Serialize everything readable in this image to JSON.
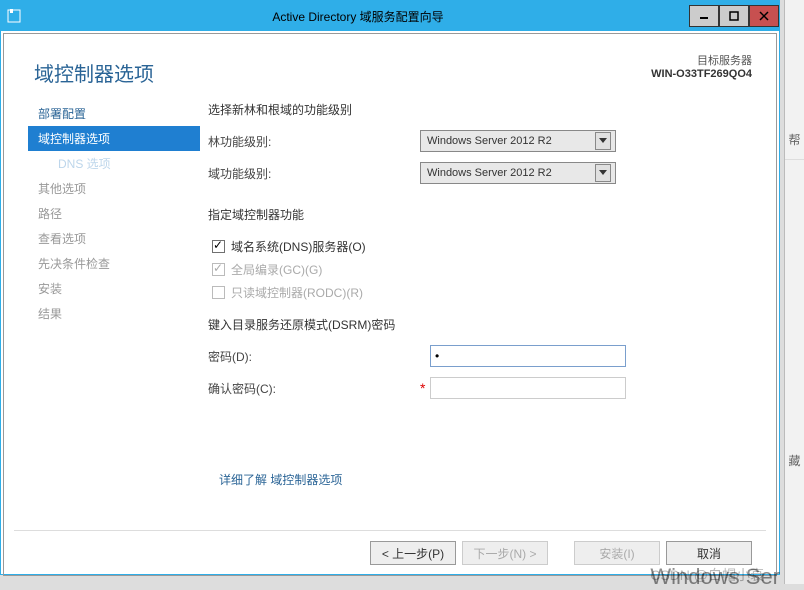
{
  "titlebar": {
    "title": "Active Directory 域服务配置向导"
  },
  "header": {
    "page_title": "域控制器选项",
    "server_label": "目标服务器",
    "server_name": "WIN-O33TF269QO4"
  },
  "sidebar": {
    "items": [
      {
        "label": "部署配置",
        "class": "link"
      },
      {
        "label": "域控制器选项",
        "class": "active"
      },
      {
        "label": "DNS 选项",
        "class": "sub"
      },
      {
        "label": "其他选项",
        "class": ""
      },
      {
        "label": "路径",
        "class": ""
      },
      {
        "label": "查看选项",
        "class": ""
      },
      {
        "label": "先决条件检查",
        "class": ""
      },
      {
        "label": "安装",
        "class": ""
      },
      {
        "label": "结果",
        "class": ""
      }
    ]
  },
  "main": {
    "section1_head": "选择新林和根域的功能级别",
    "forest_label": "林功能级别:",
    "forest_value": "Windows Server 2012 R2",
    "domain_label": "域功能级别:",
    "domain_value": "Windows Server 2012 R2",
    "section2_head": "指定域控制器功能",
    "cb_dns": "域名系统(DNS)服务器(O)",
    "cb_gc": "全局编录(GC)(G)",
    "cb_rodc": "只读域控制器(RODC)(R)",
    "section3_head": "键入目录服务还原模式(DSRM)密码",
    "pwd_label": "密码(D):",
    "pwd_value": "•",
    "confirm_label": "确认密码(C):",
    "learn_more": "详细了解 域控制器选项"
  },
  "footer": {
    "prev": "< 上一步(P)",
    "next": "下一步(N) >",
    "install": "安装(I)",
    "cancel": "取消"
  },
  "rightstrip": {
    "item1": "帮",
    "item2": "藏"
  },
  "watermark": "CSDN @白帽小衰"
}
